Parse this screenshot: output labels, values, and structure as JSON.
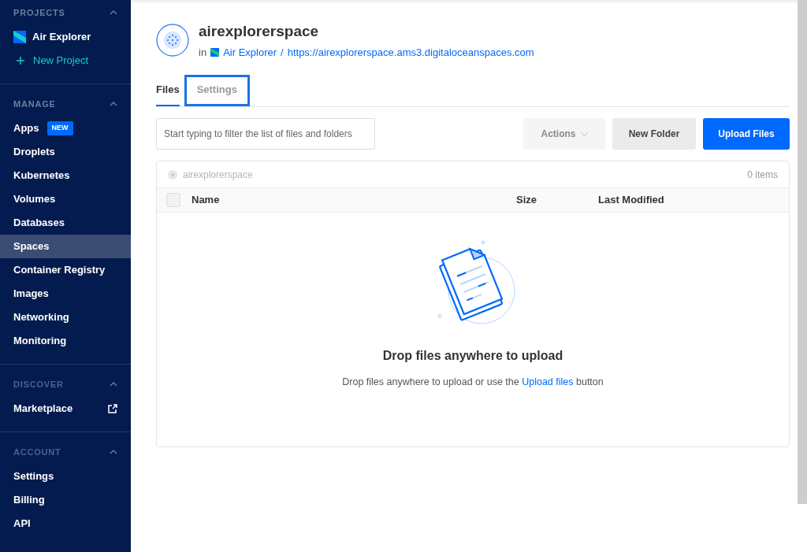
{
  "sidebar": {
    "sections": [
      {
        "title": "PROJECTS",
        "expanded": true,
        "items": [
          {
            "label": "Air Explorer",
            "kind": "project",
            "selected": false
          },
          {
            "label": "New Project",
            "kind": "add",
            "selected": false
          }
        ]
      },
      {
        "title": "MANAGE",
        "expanded": true,
        "items": [
          {
            "label": "Apps",
            "kind": "link",
            "badge": "NEW",
            "selected": false
          },
          {
            "label": "Droplets",
            "kind": "link",
            "selected": false
          },
          {
            "label": "Kubernetes",
            "kind": "link",
            "selected": false
          },
          {
            "label": "Volumes",
            "kind": "link",
            "selected": false
          },
          {
            "label": "Databases",
            "kind": "link",
            "selected": false
          },
          {
            "label": "Spaces",
            "kind": "link",
            "selected": true
          },
          {
            "label": "Container Registry",
            "kind": "link",
            "selected": false
          },
          {
            "label": "Images",
            "kind": "link",
            "selected": false
          },
          {
            "label": "Networking",
            "kind": "link",
            "selected": false
          },
          {
            "label": "Monitoring",
            "kind": "link",
            "selected": false
          }
        ]
      },
      {
        "title": "DISCOVER",
        "expanded": true,
        "items": [
          {
            "label": "Marketplace",
            "kind": "external",
            "selected": false
          }
        ]
      },
      {
        "title": "ACCOUNT",
        "expanded": true,
        "items": [
          {
            "label": "Settings",
            "kind": "link",
            "selected": false
          },
          {
            "label": "Billing",
            "kind": "link",
            "selected": false
          },
          {
            "label": "API",
            "kind": "link",
            "selected": false
          }
        ]
      }
    ]
  },
  "header": {
    "title": "airexplorerspace",
    "prefix": "in",
    "project": "Air Explorer",
    "separator": "/",
    "url": "https://airexplorerspace.ams3.digitaloceanspaces.com"
  },
  "tabs": [
    {
      "label": "Files",
      "selected": true,
      "outlined": false
    },
    {
      "label": "Settings",
      "selected": false,
      "outlined": true
    }
  ],
  "toolbar": {
    "filter": {
      "placeholder": "Start typing to filter the list of files and folders"
    },
    "buttons": [
      {
        "label": "Actions",
        "kind": "dropdown",
        "disabled": true
      },
      {
        "label": "New Folder",
        "kind": "secondary",
        "disabled": false
      },
      {
        "label": "Upload Files",
        "kind": "primary",
        "disabled": false
      }
    ]
  },
  "browser": {
    "path": "airexplorerspace",
    "count": "0 items",
    "select_all": {
      "checked": false
    },
    "columns": [
      "Name",
      "Size",
      "Last Modified"
    ],
    "empty": {
      "heading": "Drop files anywhere to upload",
      "before": "Drop files anywhere to upload or use the",
      "link": "Upload files",
      "after": "button"
    }
  }
}
